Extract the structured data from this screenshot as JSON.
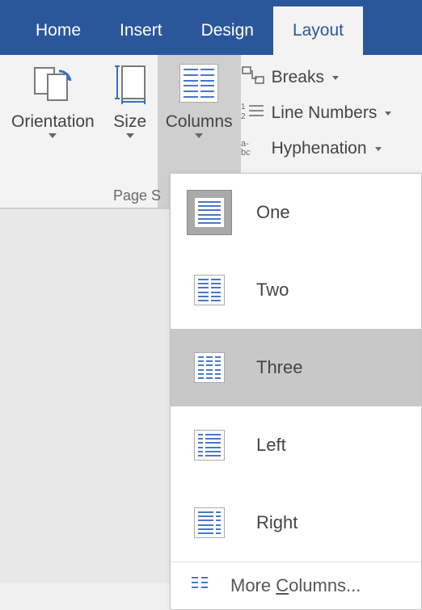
{
  "tabs": {
    "home": "Home",
    "insert": "Insert",
    "design": "Design",
    "layout": "Layout"
  },
  "ribbon": {
    "orientation": "Orientation",
    "size": "Size",
    "columns": "Columns",
    "breaks": "Breaks",
    "line_numbers": "Line Numbers",
    "hyphenation": "Hyphenation",
    "group_caption": "Page S"
  },
  "dropdown": {
    "one": "One",
    "two": "Two",
    "three": "Three",
    "left": "Left",
    "right": "Right",
    "more": "More Columns..."
  }
}
